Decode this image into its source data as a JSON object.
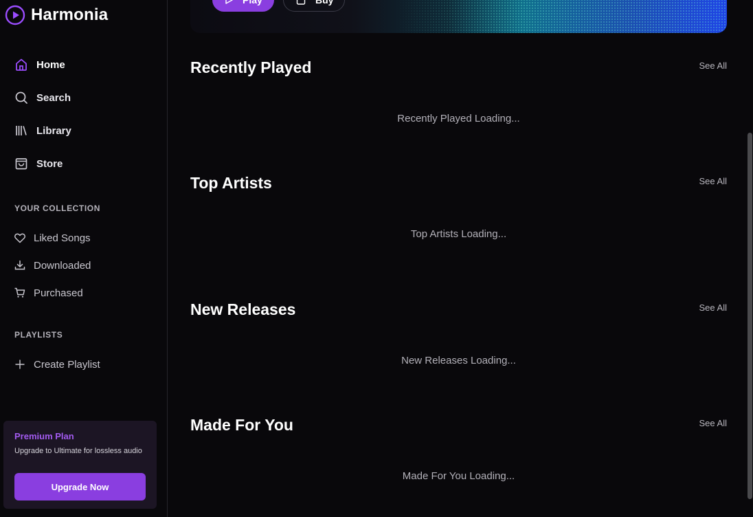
{
  "app": {
    "name": "Harmonia",
    "accent": "#8a3ee0"
  },
  "sidebar": {
    "nav": [
      {
        "label": "Home",
        "icon": "home-icon",
        "active": true
      },
      {
        "label": "Search",
        "icon": "search-icon"
      },
      {
        "label": "Library",
        "icon": "library-icon"
      },
      {
        "label": "Store",
        "icon": "store-icon"
      }
    ],
    "collection_label": "YOUR COLLECTION",
    "collection": [
      {
        "label": "Liked Songs",
        "icon": "heart-icon"
      },
      {
        "label": "Downloaded",
        "icon": "download-icon"
      },
      {
        "label": "Purchased",
        "icon": "cart-icon"
      }
    ],
    "playlists_label": "PLAYLISTS",
    "create_playlist": "Create Playlist",
    "premium": {
      "title": "Premium Plan",
      "description": "Upgrade to Ultimate for lossless audio",
      "button": "Upgrade Now"
    }
  },
  "hero": {
    "play_label": "Play",
    "buy_label": "Buy"
  },
  "sections": [
    {
      "title": "Recently Played",
      "see_all": "See All",
      "loading": "Recently Played Loading..."
    },
    {
      "title": "Top Artists",
      "see_all": "See All",
      "loading": "Top Artists Loading..."
    },
    {
      "title": "New Releases",
      "see_all": "See All",
      "loading": "New Releases Loading..."
    },
    {
      "title": "Made For You",
      "see_all": "See All",
      "loading": "Made For You Loading..."
    }
  ]
}
